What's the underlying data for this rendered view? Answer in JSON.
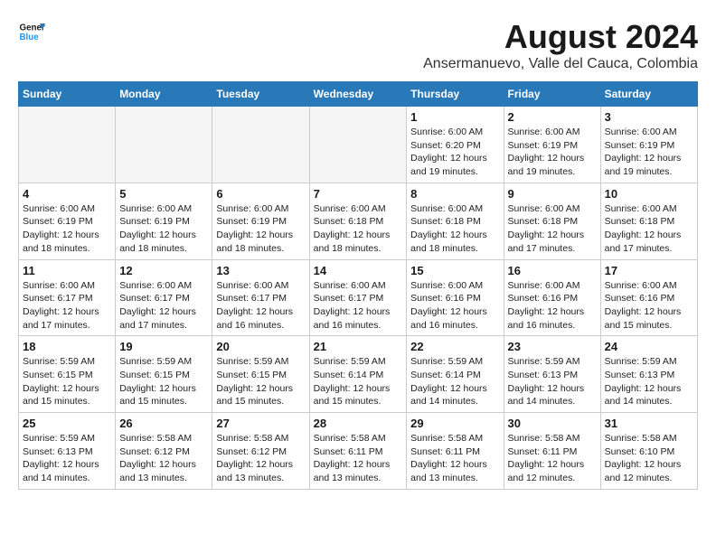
{
  "header": {
    "logo_line1": "General",
    "logo_line2": "Blue",
    "main_title": "August 2024",
    "sub_title": "Ansermanuevo, Valle del Cauca, Colombia"
  },
  "weekdays": [
    "Sunday",
    "Monday",
    "Tuesday",
    "Wednesday",
    "Thursday",
    "Friday",
    "Saturday"
  ],
  "weeks": [
    [
      {
        "day": "",
        "info": ""
      },
      {
        "day": "",
        "info": ""
      },
      {
        "day": "",
        "info": ""
      },
      {
        "day": "",
        "info": ""
      },
      {
        "day": "1",
        "info": "Sunrise: 6:00 AM\nSunset: 6:20 PM\nDaylight: 12 hours\nand 19 minutes."
      },
      {
        "day": "2",
        "info": "Sunrise: 6:00 AM\nSunset: 6:19 PM\nDaylight: 12 hours\nand 19 minutes."
      },
      {
        "day": "3",
        "info": "Sunrise: 6:00 AM\nSunset: 6:19 PM\nDaylight: 12 hours\nand 19 minutes."
      }
    ],
    [
      {
        "day": "4",
        "info": "Sunrise: 6:00 AM\nSunset: 6:19 PM\nDaylight: 12 hours\nand 18 minutes."
      },
      {
        "day": "5",
        "info": "Sunrise: 6:00 AM\nSunset: 6:19 PM\nDaylight: 12 hours\nand 18 minutes."
      },
      {
        "day": "6",
        "info": "Sunrise: 6:00 AM\nSunset: 6:19 PM\nDaylight: 12 hours\nand 18 minutes."
      },
      {
        "day": "7",
        "info": "Sunrise: 6:00 AM\nSunset: 6:18 PM\nDaylight: 12 hours\nand 18 minutes."
      },
      {
        "day": "8",
        "info": "Sunrise: 6:00 AM\nSunset: 6:18 PM\nDaylight: 12 hours\nand 18 minutes."
      },
      {
        "day": "9",
        "info": "Sunrise: 6:00 AM\nSunset: 6:18 PM\nDaylight: 12 hours\nand 17 minutes."
      },
      {
        "day": "10",
        "info": "Sunrise: 6:00 AM\nSunset: 6:18 PM\nDaylight: 12 hours\nand 17 minutes."
      }
    ],
    [
      {
        "day": "11",
        "info": "Sunrise: 6:00 AM\nSunset: 6:17 PM\nDaylight: 12 hours\nand 17 minutes."
      },
      {
        "day": "12",
        "info": "Sunrise: 6:00 AM\nSunset: 6:17 PM\nDaylight: 12 hours\nand 17 minutes."
      },
      {
        "day": "13",
        "info": "Sunrise: 6:00 AM\nSunset: 6:17 PM\nDaylight: 12 hours\nand 16 minutes."
      },
      {
        "day": "14",
        "info": "Sunrise: 6:00 AM\nSunset: 6:17 PM\nDaylight: 12 hours\nand 16 minutes."
      },
      {
        "day": "15",
        "info": "Sunrise: 6:00 AM\nSunset: 6:16 PM\nDaylight: 12 hours\nand 16 minutes."
      },
      {
        "day": "16",
        "info": "Sunrise: 6:00 AM\nSunset: 6:16 PM\nDaylight: 12 hours\nand 16 minutes."
      },
      {
        "day": "17",
        "info": "Sunrise: 6:00 AM\nSunset: 6:16 PM\nDaylight: 12 hours\nand 15 minutes."
      }
    ],
    [
      {
        "day": "18",
        "info": "Sunrise: 5:59 AM\nSunset: 6:15 PM\nDaylight: 12 hours\nand 15 minutes."
      },
      {
        "day": "19",
        "info": "Sunrise: 5:59 AM\nSunset: 6:15 PM\nDaylight: 12 hours\nand 15 minutes."
      },
      {
        "day": "20",
        "info": "Sunrise: 5:59 AM\nSunset: 6:15 PM\nDaylight: 12 hours\nand 15 minutes."
      },
      {
        "day": "21",
        "info": "Sunrise: 5:59 AM\nSunset: 6:14 PM\nDaylight: 12 hours\nand 15 minutes."
      },
      {
        "day": "22",
        "info": "Sunrise: 5:59 AM\nSunset: 6:14 PM\nDaylight: 12 hours\nand 14 minutes."
      },
      {
        "day": "23",
        "info": "Sunrise: 5:59 AM\nSunset: 6:13 PM\nDaylight: 12 hours\nand 14 minutes."
      },
      {
        "day": "24",
        "info": "Sunrise: 5:59 AM\nSunset: 6:13 PM\nDaylight: 12 hours\nand 14 minutes."
      }
    ],
    [
      {
        "day": "25",
        "info": "Sunrise: 5:59 AM\nSunset: 6:13 PM\nDaylight: 12 hours\nand 14 minutes."
      },
      {
        "day": "26",
        "info": "Sunrise: 5:58 AM\nSunset: 6:12 PM\nDaylight: 12 hours\nand 13 minutes."
      },
      {
        "day": "27",
        "info": "Sunrise: 5:58 AM\nSunset: 6:12 PM\nDaylight: 12 hours\nand 13 minutes."
      },
      {
        "day": "28",
        "info": "Sunrise: 5:58 AM\nSunset: 6:11 PM\nDaylight: 12 hours\nand 13 minutes."
      },
      {
        "day": "29",
        "info": "Sunrise: 5:58 AM\nSunset: 6:11 PM\nDaylight: 12 hours\nand 13 minutes."
      },
      {
        "day": "30",
        "info": "Sunrise: 5:58 AM\nSunset: 6:11 PM\nDaylight: 12 hours\nand 12 minutes."
      },
      {
        "day": "31",
        "info": "Sunrise: 5:58 AM\nSunset: 6:10 PM\nDaylight: 12 hours\nand 12 minutes."
      }
    ]
  ]
}
